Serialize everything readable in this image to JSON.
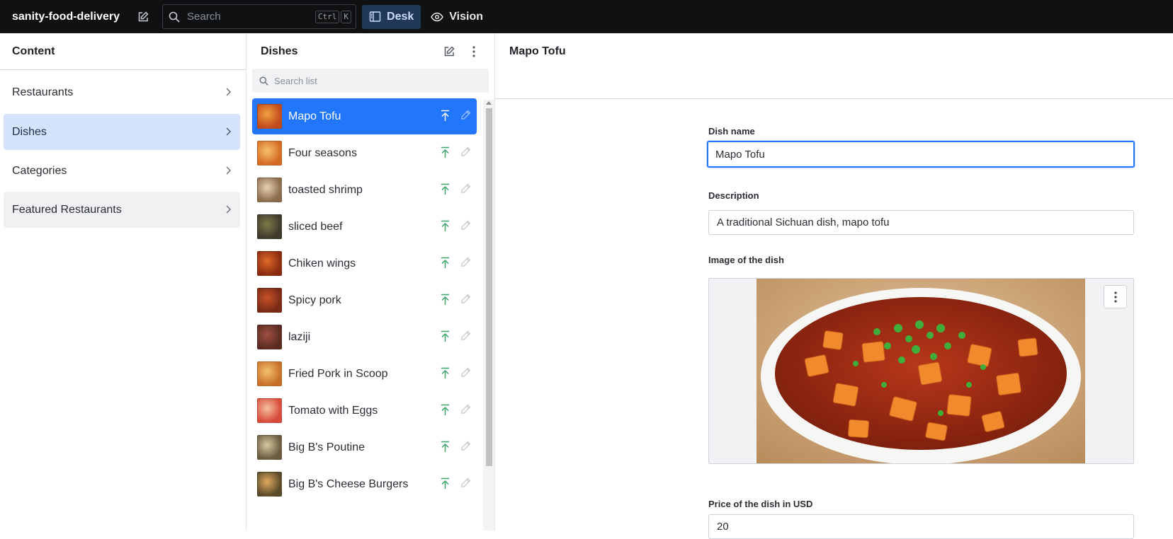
{
  "topbar": {
    "project_name": "sanity-food-delivery",
    "search_placeholder": "Search",
    "shortcut_keys": [
      "Ctrl",
      "K"
    ],
    "tools": [
      {
        "label": "Desk",
        "icon": "desk-icon",
        "active": true
      },
      {
        "label": "Vision",
        "icon": "eye-icon",
        "active": false
      }
    ]
  },
  "content_pane": {
    "title": "Content",
    "items": [
      {
        "label": "Restaurants",
        "state": "default"
      },
      {
        "label": "Dishes",
        "state": "active"
      },
      {
        "label": "Categories",
        "state": "default"
      },
      {
        "label": "Featured Restaurants",
        "state": "hover"
      }
    ]
  },
  "dishes_pane": {
    "title": "Dishes",
    "search_placeholder": "Search list",
    "items": [
      {
        "label": "Mapo Tofu",
        "selected": true
      },
      {
        "label": "Four seasons",
        "selected": false
      },
      {
        "label": "toasted shrimp",
        "selected": false
      },
      {
        "label": "sliced beef",
        "selected": false
      },
      {
        "label": "Chiken wings",
        "selected": false
      },
      {
        "label": "Spicy pork",
        "selected": false
      },
      {
        "label": "laziji",
        "selected": false
      },
      {
        "label": "Fried Pork in Scoop",
        "selected": false
      },
      {
        "label": "Tomato with Eggs",
        "selected": false
      },
      {
        "label": "Big B's Poutine",
        "selected": false
      },
      {
        "label": "Big B's Cheese Burgers",
        "selected": false
      }
    ]
  },
  "document": {
    "title": "Mapo Tofu",
    "fields": {
      "name_label": "Dish name",
      "name_value": "Mapo Tofu",
      "description_label": "Description",
      "description_value": "A traditional Sichuan dish, mapo tofu",
      "image_label": "Image of the dish",
      "price_label": "Price of the dish in USD",
      "price_value": "20"
    }
  },
  "colors": {
    "topbar_bg": "#101112",
    "accent": "#2276fc",
    "active_nav_bg": "#d4e3fb",
    "publish_icon": "#3ca66a"
  }
}
